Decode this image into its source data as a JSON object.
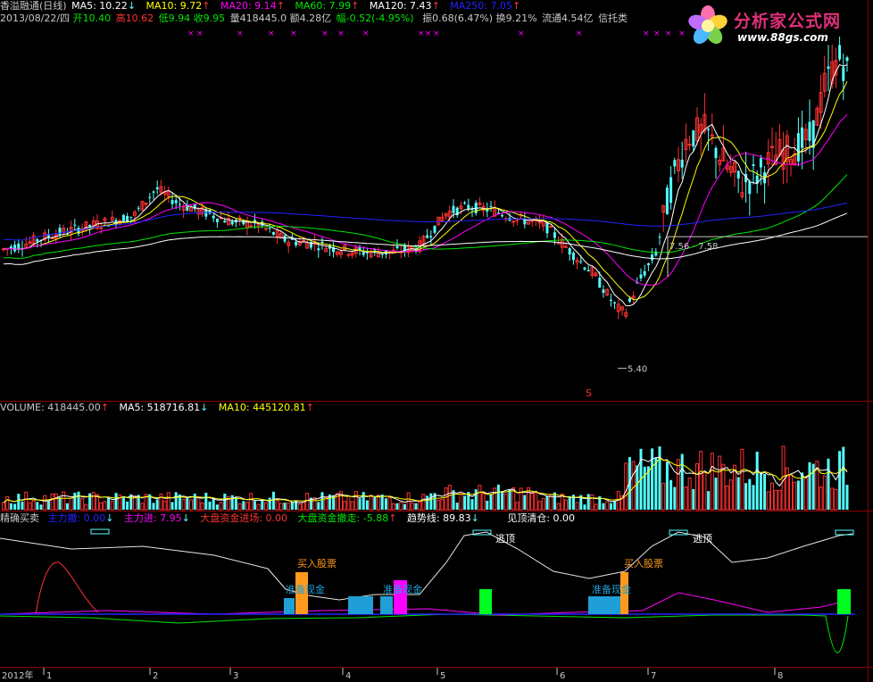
{
  "price_panel": {
    "header1": {
      "title": "香溢融通(日线)",
      "ma5": "MA5: 10.22",
      "ma10": "MA10: 9.72",
      "ma20": "MA20: 9.14",
      "ma60": "MA60: 7.99",
      "ma120": "MA120: 7.43",
      "ma250": "MA250: 7.05"
    },
    "header2": {
      "date": "2013/08/22/四",
      "open": "开10.40",
      "high": "高10.62",
      "low": "低9.94",
      "close": "收9.95",
      "vol": "量418445.0",
      "amount": "额4.28亿",
      "change": "幅-0.52(-4.95%)",
      "amplitude": "振0.68(6.47%)",
      "turnover": "换9.21%",
      "float": "流通4.54亿",
      "sector": "信托类"
    },
    "annotations": {
      "low_label": "5.40",
      "range_label": "7.56 - 7.58",
      "s_marker": "S"
    }
  },
  "volume_panel": {
    "header": {
      "volume": "VOLUME: 418445.00",
      "ma5": "MA5: 518716.81",
      "ma10": "MA10: 445120.81"
    }
  },
  "indicator_panel": {
    "header": {
      "name": "精确买卖",
      "main_out": "主力撤: 0.00",
      "main_in": "主力进: 7.95",
      "market_in": "大盘资金进场: 0.00",
      "market_out": "大盘资金撤走: -5.88",
      "trend": "趋势线: 89.83",
      "top_clear": "见顶清仓: 0.00"
    },
    "labels": {
      "buy1": "买入股票",
      "buy2": "买入股票",
      "prep1": "准备现金",
      "prep2": "准备现金",
      "prep3": "准备现金",
      "top1": "逃顶",
      "top2": "逃顶"
    }
  },
  "x_axis": {
    "year": "2012年",
    "months": [
      "1",
      "2",
      "3",
      "4",
      "5",
      "6",
      "7",
      "8"
    ]
  },
  "watermark": {
    "title": "分析家公式网",
    "url": "www.88gs.com"
  },
  "colors": {
    "up": "#ff3232",
    "down": "#54ffff",
    "ma5": "#ffffff",
    "ma10": "#ffff00",
    "ma20": "#ff00ff",
    "ma60": "#00e600",
    "ma120": "#ffffff",
    "ma250": "#2323ff",
    "border": "#8a0000"
  },
  "chart_data": {
    "type": "candlestick",
    "title": "香溢融通(日线)",
    "low_marker": 5.4,
    "range_marker": [
      7.56,
      7.58
    ],
    "last_bar": {
      "open": 10.4,
      "high": 10.62,
      "low": 9.94,
      "close": 9.95,
      "volume": 418445.0
    },
    "moving_averages": {
      "MA5": 10.22,
      "MA10": 9.72,
      "MA20": 9.14,
      "MA60": 7.99,
      "MA120": 7.43,
      "MA250": 7.05
    },
    "volume_ma": {
      "MA5": 518716.81,
      "MA10": 445120.81
    },
    "indicator": {
      "主力撤": 0.0,
      "主力进": 7.95,
      "大盘资金进场": 0.0,
      "大盘资金撤走": -5.88,
      "趋势线": 89.83,
      "见顶清仓": 0.0
    }
  }
}
